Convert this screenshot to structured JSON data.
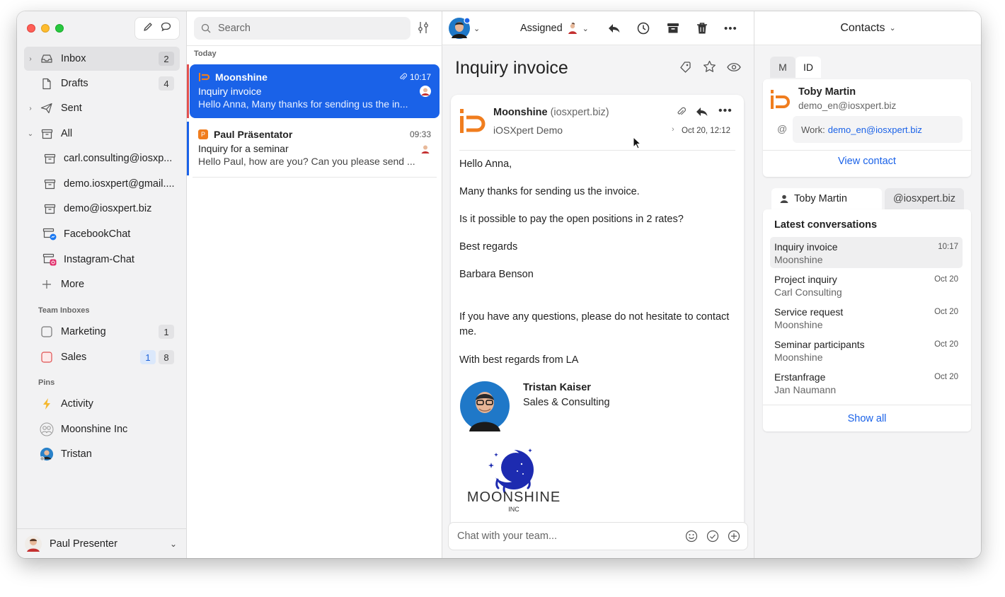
{
  "sidebar": {
    "compose_icon": "pencil-icon",
    "chat_icon": "chat-bubble-icon",
    "items": [
      {
        "label": "Inbox",
        "count": "2",
        "icon": "inbox-icon"
      },
      {
        "label": "Drafts",
        "count": "4",
        "icon": "document-icon"
      },
      {
        "label": "Sent",
        "icon": "paper-plane-icon"
      },
      {
        "label": "All",
        "icon": "archive-icon"
      },
      {
        "label": "carl.consulting@iosxp...",
        "icon": "archive-icon"
      },
      {
        "label": "demo.iosxpert@gmail....",
        "icon": "archive-icon"
      },
      {
        "label": "demo@iosxpert.biz",
        "icon": "archive-icon"
      },
      {
        "label": "FacebookChat",
        "icon": "messenger-icon"
      },
      {
        "label": "Instagram-Chat",
        "icon": "instagram-icon"
      },
      {
        "label": "More",
        "icon": "plus-icon"
      }
    ],
    "team_header": "Team Inboxes",
    "team": [
      {
        "label": "Marketing",
        "count": "1"
      },
      {
        "label": "Sales",
        "count_a": "1",
        "count_b": "8"
      }
    ],
    "pins_header": "Pins",
    "pins": [
      {
        "label": "Activity",
        "icon": "lightning-icon"
      },
      {
        "label": "Moonshine Inc",
        "icon": "group-icon"
      },
      {
        "label": "Tristan",
        "icon": "avatar"
      }
    ],
    "footer_user": "Paul Presenter"
  },
  "list": {
    "search_placeholder": "Search",
    "section": "Today",
    "messages": [
      {
        "sender": "Moonshine",
        "time": "10:17",
        "subject": "Inquiry invoice",
        "preview": "Hello Anna, Many thanks for sending us the in..."
      },
      {
        "sender": "Paul Präsentator",
        "time": "09:33",
        "subject": "Inquiry for a seminar",
        "preview": "Hello Paul, how are you? Can you please send ..."
      }
    ]
  },
  "toolbar": {
    "assigned_label": "Assigned"
  },
  "message": {
    "title": "Inquiry invoice",
    "from_name": "Moonshine",
    "from_domain": "(iosxpert.biz)",
    "account": "iOSXpert Demo",
    "date": "Oct 20, 12:12",
    "body": [
      "Hello Anna,",
      "Many thanks for sending us the invoice.",
      "Is it possible to pay the open positions in 2 rates?",
      "Best regards",
      "Barbara Benson",
      "If you have any questions, please do not hesitate to contact me.",
      "With best regards from LA"
    ],
    "sig_name": "Tristan Kaiser",
    "sig_role": "Sales & Consulting",
    "logo_text": "MOONSHINE",
    "logo_sub": "INC",
    "chat_placeholder": "Chat with your team..."
  },
  "right": {
    "header": "Contacts",
    "tabs": [
      "M",
      "ID"
    ],
    "contact_name": "Toby Martin",
    "contact_email": "demo_en@iosxpert.biz",
    "work_label": "Work:",
    "work_email": "demo_en@iosxpert.biz",
    "view_contact": "View contact",
    "subtab_person": "Toby Martin",
    "subtab_domain": "@iosxpert.biz",
    "latest_header": "Latest conversations",
    "conversations": [
      {
        "subject": "Inquiry invoice",
        "sender": "Moonshine",
        "time": "10:17"
      },
      {
        "subject": "Project inquiry",
        "sender": "Carl Consulting",
        "time": "Oct 20"
      },
      {
        "subject": "Service request",
        "sender": "Moonshine",
        "time": "Oct 20"
      },
      {
        "subject": "Seminar participants",
        "sender": "Moonshine",
        "time": "Oct 20"
      },
      {
        "subject": "Erstanfrage",
        "sender": "Jan Naumann",
        "time": "Oct 20"
      }
    ],
    "show_all": "Show all"
  },
  "colors": {
    "accent": "#1a62e8",
    "brand_orange": "#f07d1e"
  }
}
